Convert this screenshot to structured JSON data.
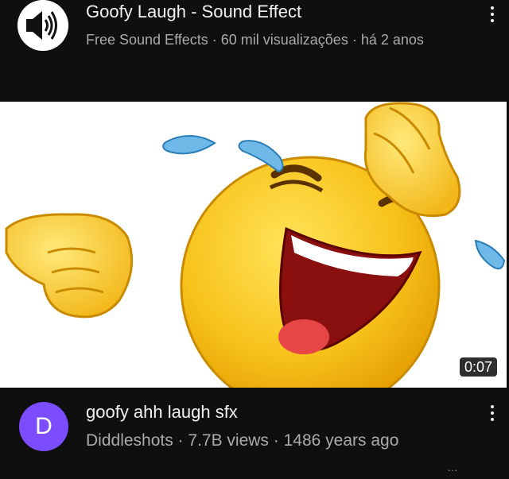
{
  "video1": {
    "title": "Goofy Laugh - Sound Effect",
    "meta": "Free Sound Effects · 60 mil visualizações · há 2 anos",
    "duration": "0:07",
    "avatar_icon": "speaker-icon"
  },
  "video2": {
    "avatar_letter": "D",
    "avatar_color": "#7c4dff",
    "title": "goofy ahh laugh sfx",
    "meta": "Diddleshots · 7.7B views · 1486 years ago"
  },
  "more_indicator": "..."
}
